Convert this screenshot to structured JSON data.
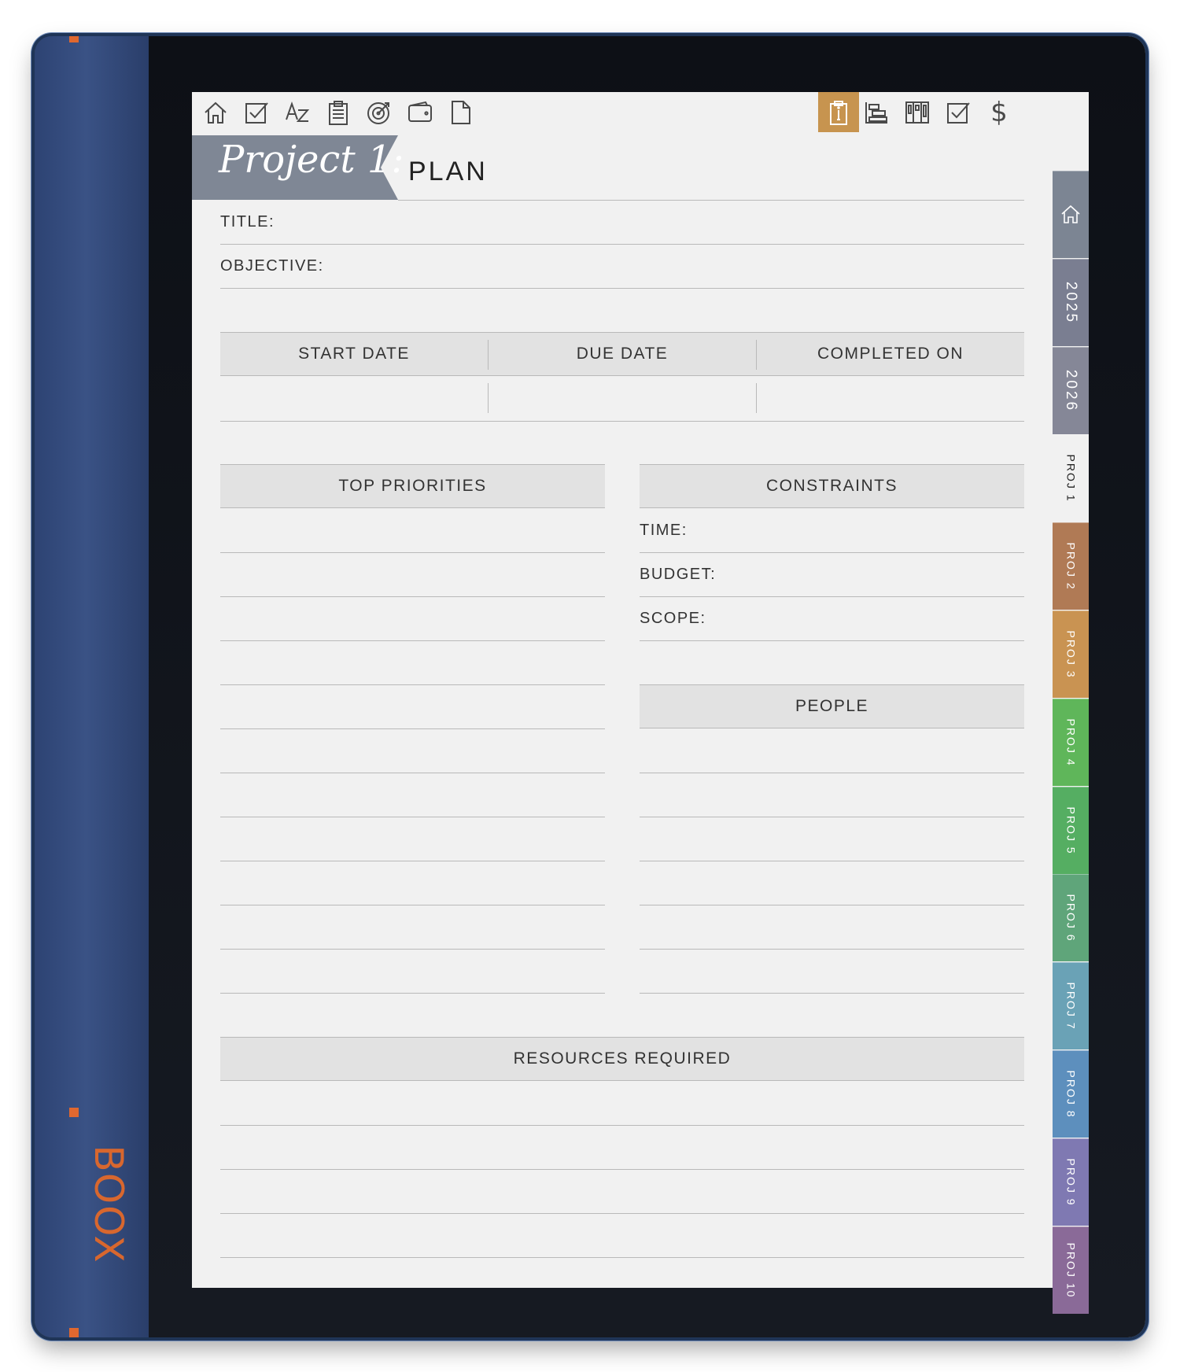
{
  "device": {
    "brand": "BOOX"
  },
  "toolbar": {
    "left_icons": [
      "home-icon",
      "checkbox-icon",
      "az-sort-icon",
      "clipboard-icon",
      "target-icon",
      "wallet-icon",
      "page-icon"
    ],
    "right_icons": [
      "info-clipboard-icon",
      "gantt-icon",
      "kanban-icon",
      "checkbox-icon",
      "dollar-icon"
    ],
    "dollar_glyph": "$",
    "active_color": "#c7944f"
  },
  "header": {
    "banner": "Project 1:",
    "title": "PLAN"
  },
  "fields": {
    "title_label": "TITLE:",
    "objective_label": "OBJECTIVE:"
  },
  "dates": {
    "start": "START DATE",
    "due": "DUE DATE",
    "completed": "COMPLETED ON"
  },
  "sections": {
    "top_priorities": "TOP PRIORITIES",
    "constraints": "CONSTRAINTS",
    "people": "PEOPLE",
    "resources": "RESOURCES REQUIRED"
  },
  "constraints": {
    "time": "TIME:",
    "budget": "BUDGET:",
    "scope": "SCOPE:"
  },
  "tabs": [
    {
      "label": "",
      "icon": "home-icon",
      "color": "#7c8593"
    },
    {
      "label": "2025",
      "color": "#7a7e91"
    },
    {
      "label": "2026",
      "color": "#858797"
    },
    {
      "label": "PROJ 1",
      "color": "#f1f1f1"
    },
    {
      "label": "PROJ 2",
      "color": "#b07a55"
    },
    {
      "label": "PROJ 3",
      "color": "#c99352"
    },
    {
      "label": "PROJ 4",
      "color": "#5fb65a"
    },
    {
      "label": "PROJ 5",
      "color": "#55ae62"
    },
    {
      "label": "PROJ 6",
      "color": "#5fa57a"
    },
    {
      "label": "PROJ 7",
      "color": "#6aa2b6"
    },
    {
      "label": "PROJ 8",
      "color": "#5d8fbd"
    },
    {
      "label": "PROJ 9",
      "color": "#7f79b2"
    },
    {
      "label": "PROJ 10",
      "color": "#8a6a98"
    }
  ]
}
